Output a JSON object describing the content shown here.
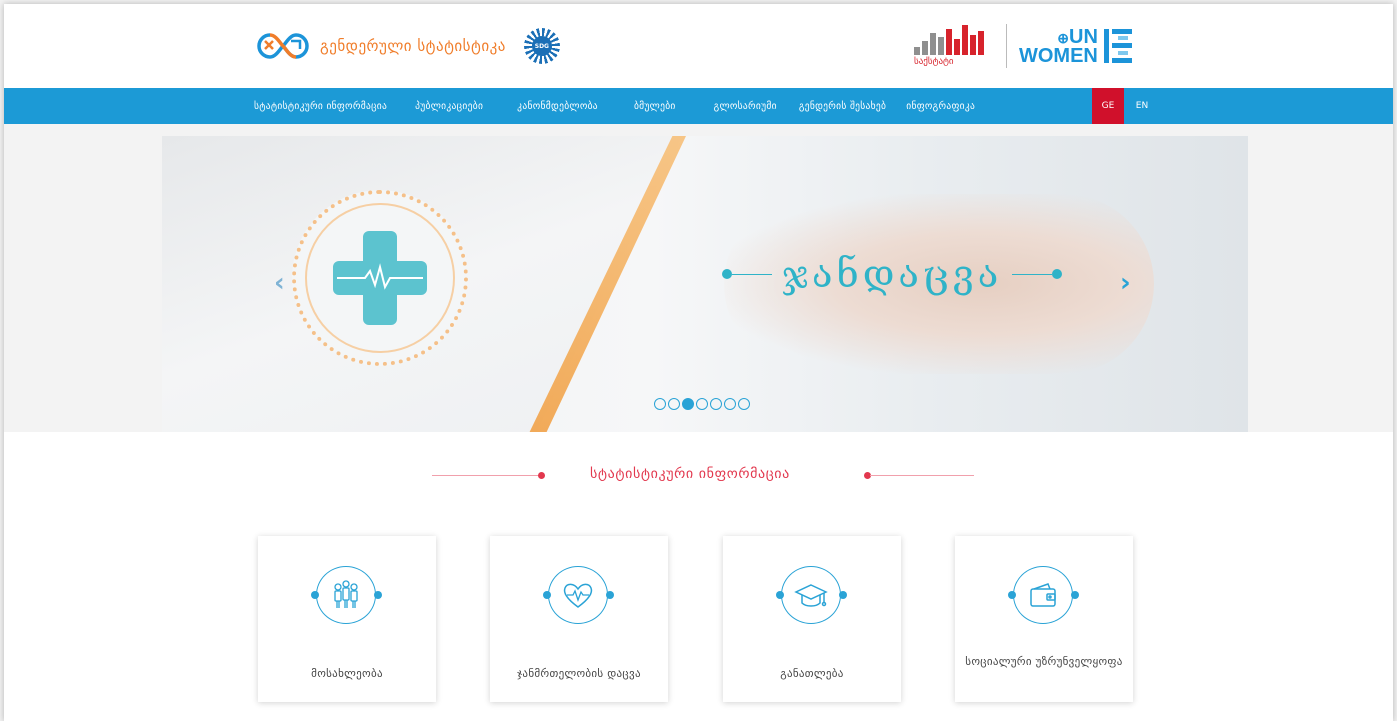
{
  "header": {
    "brand_title": "გენდერული სტატისტიკა",
    "sdg_badge": "SDG",
    "geostat_label": "საქსტატი",
    "unwomen_line1": "UN",
    "unwomen_line2": "WOMEN"
  },
  "nav": {
    "items": [
      {
        "label": "სტატისტიკური ინფორმაცია"
      },
      {
        "label": "პუბლიკაციები"
      },
      {
        "label": "კანონმდებლობა"
      },
      {
        "label": "ბმულები"
      },
      {
        "label": "გლოსარიუმი"
      },
      {
        "label": "გენდერის შესახებ"
      },
      {
        "label": "ინფოგრაფიკა"
      }
    ],
    "lang_ge": "GE",
    "lang_en": "EN"
  },
  "slider": {
    "title": "ჯანდაცვა",
    "prev_icon": "chevron-left-icon",
    "next_icon": "chevron-right-icon",
    "dot_count": 7,
    "active_dot": 2
  },
  "section": {
    "title": "სტატისტიკური ინფორმაცია"
  },
  "cards": [
    {
      "icon": "people-icon",
      "label": "მოსახლეობა"
    },
    {
      "icon": "heart-pulse-icon",
      "label": "ჯანმრთელობის დაცვა"
    },
    {
      "icon": "graduation-cap-icon",
      "label": "განათლება"
    },
    {
      "icon": "wallet-icon",
      "label": "სოციალური უზრუნველყოფა"
    }
  ],
  "colors": {
    "nav_bg": "#1c9ad6",
    "lang_active": "#d0102b",
    "accent_teal": "#2fb3c8",
    "section_red": "#e2384e",
    "brand_orange": "#f07d2a"
  }
}
